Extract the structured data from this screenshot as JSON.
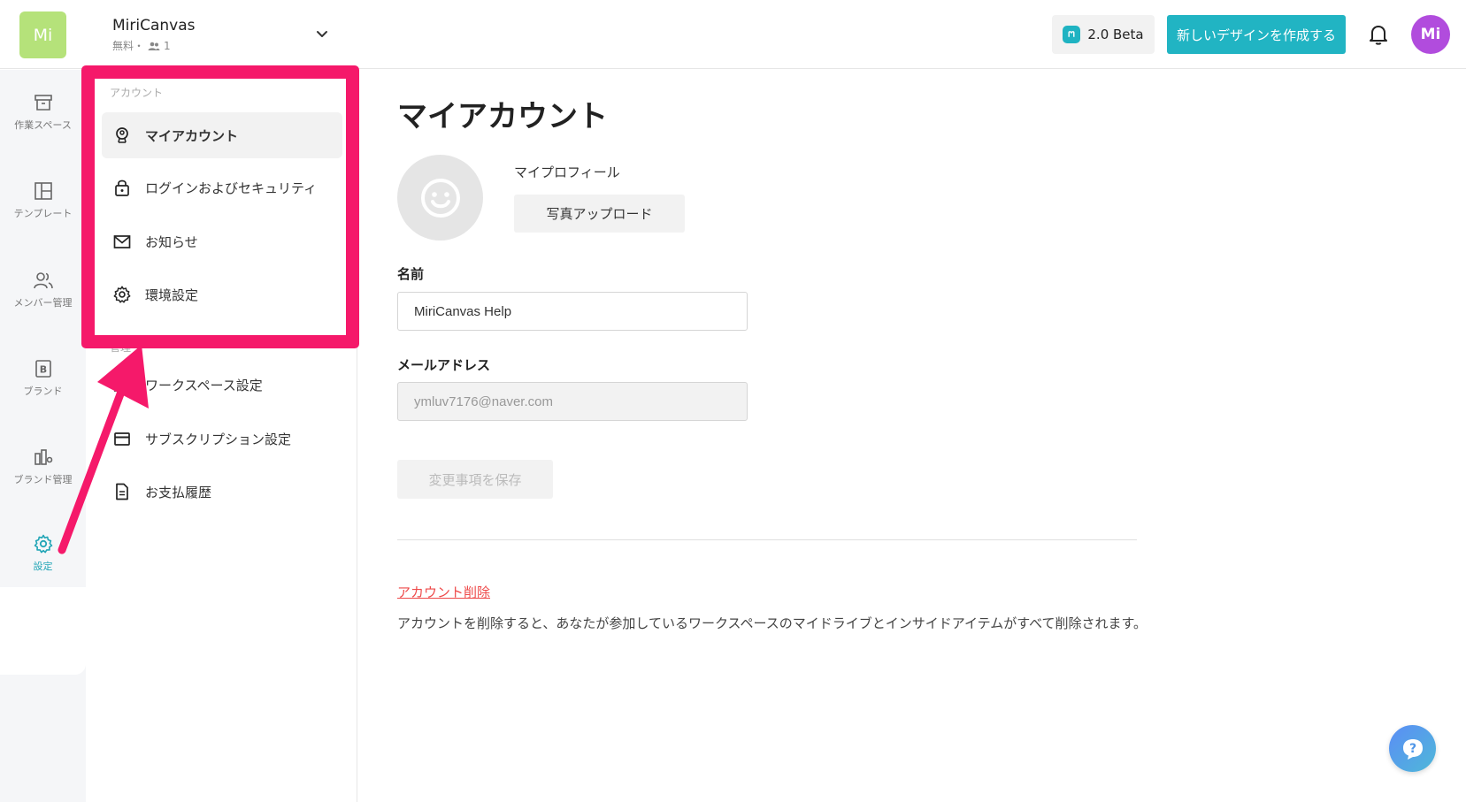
{
  "topbar": {
    "workspace_logo": "Mi",
    "workspace_name": "MiriCanvas",
    "workspace_plan": "無料・",
    "workspace_members": "1",
    "beta_label": "2.0 Beta",
    "create_label": "新しいデザインを作成する",
    "avatar_initials": "Mi",
    "colors": {
      "accent": "#21b4c3",
      "avatar": "#b14cdd",
      "logo": "#b5e27a"
    }
  },
  "rail": {
    "items": [
      {
        "label": "作業スペース",
        "icon": "archive-box-icon"
      },
      {
        "label": "テンプレート",
        "icon": "layout-icon"
      },
      {
        "label": "メンバー管理",
        "icon": "users-icon"
      },
      {
        "label": "ブランド",
        "icon": "brand-b-icon"
      },
      {
        "label": "ブランド管理",
        "icon": "brand-manage-icon"
      },
      {
        "label": "設定",
        "icon": "gear-icon"
      }
    ],
    "collapse_icon": "double-chevron-left-icon"
  },
  "subnav": {
    "account_section": "アカウント",
    "workspace_section": "管理",
    "account_items": [
      {
        "label": "マイアカウント",
        "icon": "user-badge-icon"
      },
      {
        "label": "ログインおよびセキュリティ",
        "icon": "lock-icon"
      },
      {
        "label": "お知らせ",
        "icon": "mail-icon"
      },
      {
        "label": "環境設定",
        "icon": "gear-icon"
      }
    ],
    "workspace_items": [
      {
        "label": "ワークスペース設定",
        "icon": "workspace-icon"
      },
      {
        "label": "サブスクリプション設定",
        "icon": "card-icon"
      },
      {
        "label": "お支払履歴",
        "icon": "document-icon"
      }
    ],
    "highlight_color": "#f5196a"
  },
  "main": {
    "title": "マイアカウント",
    "profile_label": "マイプロフィール",
    "upload_label": "写真アップロード",
    "name_label": "名前",
    "name_value": "MiriCanvas Help",
    "email_label": "メールアドレス",
    "email_value": "ymluv7176@naver.com",
    "save_label": "変更事項を保存",
    "delete_link": "アカウント削除",
    "delete_description": "アカウントを削除すると、あなたが参加しているワークスペースのマイドライブとインサイドアイテムがすべて削除されます。"
  }
}
